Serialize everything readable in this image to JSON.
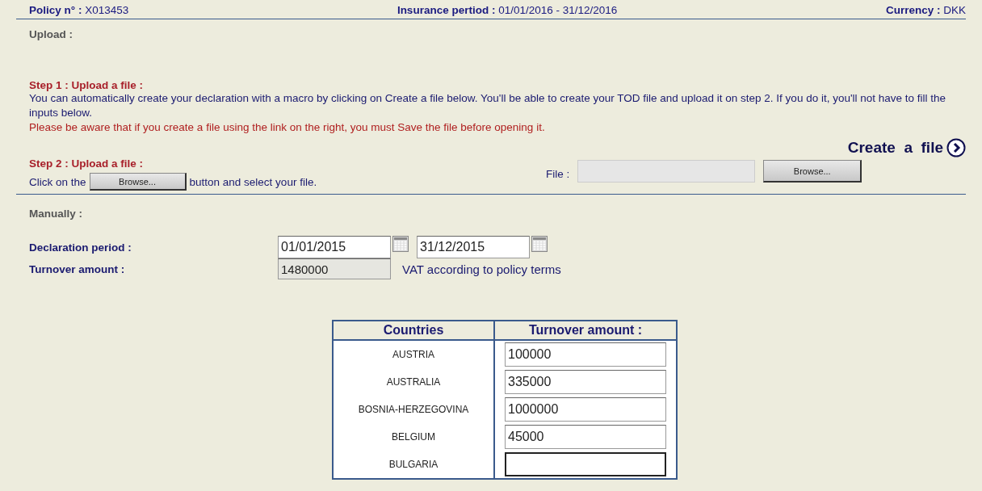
{
  "header": {
    "policy_label": "Policy n° :",
    "policy_value": "X013453",
    "period_label": "Insurance pertiod :",
    "period_value": "01/01/2016 - 31/12/2016",
    "currency_label": "Currency :",
    "currency_value": "DKK"
  },
  "upload": {
    "title": "Upload :",
    "step1": {
      "title": "Step  1 :  Upload a file :",
      "text": "You can automatically create your declaration with a macro by clicking on Create a file below. You'll be able to create your TOD file and upload it on step 2. If you do it, you'll not have to fill the inputs below.",
      "warning": "Please be aware that if you create a file using the link on the right, you must Save the file before opening it."
    },
    "create_link": "Create  a  file",
    "step2": {
      "title": "Step  2 :  Upload a file :",
      "text_before": "Click on the",
      "inline_button": "Browse...",
      "text_after": "button and select your file."
    },
    "file_label": "File :",
    "browse_button": "Browse..."
  },
  "manual": {
    "title": "Manually :",
    "declaration_label": "Declaration period :",
    "date_from": "01/01/2015",
    "date_to": "31/12/2015",
    "turnover_label": "Turnover amount :",
    "turnover_value": "1480000",
    "vat_note": "VAT according to policy terms"
  },
  "table": {
    "columns": [
      "Countries",
      "Turnover amount :"
    ],
    "rows": [
      {
        "country": "AUSTRIA",
        "amount": "100000",
        "focused": false
      },
      {
        "country": "AUSTRALIA",
        "amount": "335000",
        "focused": false
      },
      {
        "country": "BOSNIA-HERZEGOVINA",
        "amount": "1000000",
        "focused": false
      },
      {
        "country": "BELGIUM",
        "amount": "45000",
        "focused": false
      },
      {
        "country": "BULGARIA",
        "amount": "",
        "focused": true
      }
    ]
  }
}
